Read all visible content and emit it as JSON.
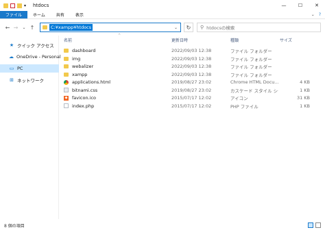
{
  "window": {
    "title": "htdocs",
    "minimize": "—",
    "maximize": "☐",
    "close": "✕"
  },
  "ribbon": {
    "tabs": [
      "ファイル",
      "ホーム",
      "共有",
      "表示"
    ],
    "expand": "⌄",
    "help": "?"
  },
  "nav": {
    "back": "←",
    "forward": "→",
    "recent": "⌄",
    "up": "↑",
    "address": "C:¥xampp¥htdocs",
    "address_dropdown": "⌄",
    "refresh": "↻",
    "search_placeholder": "htdocsの検索"
  },
  "sidebar": {
    "items": [
      {
        "label": "クイック アクセス"
      },
      {
        "label": "OneDrive - Personal"
      },
      {
        "label": "PC"
      },
      {
        "label": "ネットワーク"
      }
    ]
  },
  "columns": {
    "name": "名前",
    "date": "更新日時",
    "type": "種類",
    "size": "サイズ"
  },
  "files": [
    {
      "name": "dashboard",
      "date": "2022/09/03 12:38",
      "type": "ファイル フォルダー",
      "size": "",
      "icon": "folder-icon"
    },
    {
      "name": "img",
      "date": "2022/09/03 12:38",
      "type": "ファイル フォルダー",
      "size": "",
      "icon": "folder-icon"
    },
    {
      "name": "webalizer",
      "date": "2022/09/03 12:38",
      "type": "ファイル フォルダー",
      "size": "",
      "icon": "folder-icon"
    },
    {
      "name": "xampp",
      "date": "2022/09/03 12:38",
      "type": "ファイル フォルダー",
      "size": "",
      "icon": "folder-icon"
    },
    {
      "name": "applications.html",
      "date": "2019/08/27 23:02",
      "type": "Chrome HTML Docu...",
      "size": "4 KB",
      "icon": "chrome-icon"
    },
    {
      "name": "bitnami.css",
      "date": "2019/08/27 23:02",
      "type": "カスケード スタイル シート...",
      "size": "1 KB",
      "icon": "css-file-icon"
    },
    {
      "name": "favicon.ico",
      "date": "2015/07/17 12:02",
      "type": "アイコン",
      "size": "31 KB",
      "icon": "ico-file-icon"
    },
    {
      "name": "index.php",
      "date": "2015/07/17 12:02",
      "type": "PHP ファイル",
      "size": "1 KB",
      "icon": "php-file-icon"
    }
  ],
  "status": {
    "count": "8 個の項目"
  }
}
